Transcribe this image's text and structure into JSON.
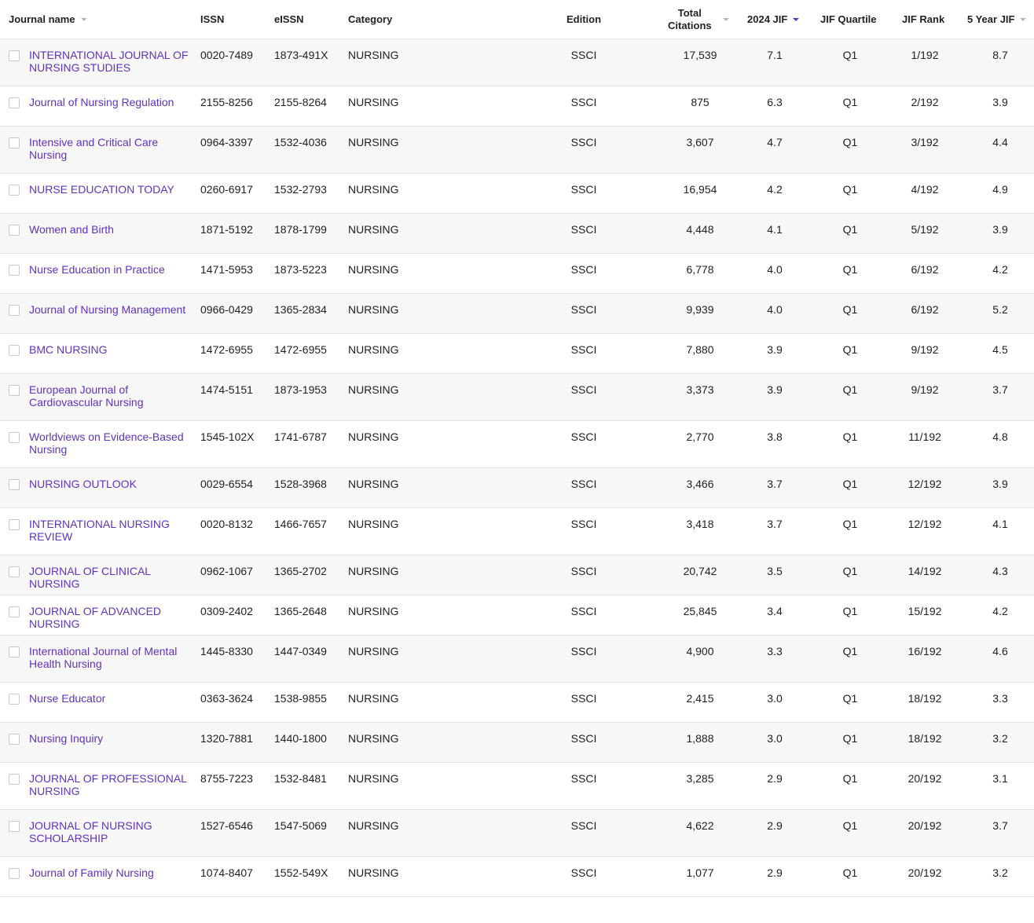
{
  "colors": {
    "link": "#5e33bf",
    "border": "#e3e3e3",
    "alt_row": "#f7f7f7",
    "active_sort": "#5e33bf"
  },
  "header": {
    "journal_name": "Journal name",
    "issn": "ISSN",
    "eissn": "eISSN",
    "category": "Category",
    "edition": "Edition",
    "total_citations_line1": "Total",
    "total_citations_line2": "Citations",
    "jif": "2024 JIF",
    "jif_quartile": "JIF Quartile",
    "jif_rank": "JIF Rank",
    "five_year_jif": "5 Year JIF"
  },
  "rows": [
    {
      "name": "INTERNATIONAL JOURNAL OF NURSING STUDIES",
      "issn": "0020-7489",
      "eissn": "1873-491X",
      "category": "NURSING",
      "edition": "SSCI",
      "citations": "17,539",
      "jif": "7.1",
      "quartile": "Q1",
      "rank": "1/192",
      "five_year": "8.7"
    },
    {
      "name": "Journal of Nursing Regulation",
      "issn": "2155-8256",
      "eissn": "2155-8264",
      "category": "NURSING",
      "edition": "SSCI",
      "citations": "875",
      "jif": "6.3",
      "quartile": "Q1",
      "rank": "2/192",
      "five_year": "3.9"
    },
    {
      "name": "Intensive and Critical Care Nursing",
      "issn": "0964-3397",
      "eissn": "1532-4036",
      "category": "NURSING",
      "edition": "SSCI",
      "citations": "3,607",
      "jif": "4.7",
      "quartile": "Q1",
      "rank": "3/192",
      "five_year": "4.4"
    },
    {
      "name": "NURSE EDUCATION TODAY",
      "issn": "0260-6917",
      "eissn": "1532-2793",
      "category": "NURSING",
      "edition": "SSCI",
      "citations": "16,954",
      "jif": "4.2",
      "quartile": "Q1",
      "rank": "4/192",
      "five_year": "4.9"
    },
    {
      "name": "Women and Birth",
      "issn": "1871-5192",
      "eissn": "1878-1799",
      "category": "NURSING",
      "edition": "SSCI",
      "citations": "4,448",
      "jif": "4.1",
      "quartile": "Q1",
      "rank": "5/192",
      "five_year": "3.9"
    },
    {
      "name": "Nurse Education in Practice",
      "issn": "1471-5953",
      "eissn": "1873-5223",
      "category": "NURSING",
      "edition": "SSCI",
      "citations": "6,778",
      "jif": "4.0",
      "quartile": "Q1",
      "rank": "6/192",
      "five_year": "4.2"
    },
    {
      "name": "Journal of Nursing Management",
      "issn": "0966-0429",
      "eissn": "1365-2834",
      "category": "NURSING",
      "edition": "SSCI",
      "citations": "9,939",
      "jif": "4.0",
      "quartile": "Q1",
      "rank": "6/192",
      "five_year": "5.2"
    },
    {
      "name": "BMC NURSING",
      "issn": "1472-6955",
      "eissn": "1472-6955",
      "category": "NURSING",
      "edition": "SSCI",
      "citations": "7,880",
      "jif": "3.9",
      "quartile": "Q1",
      "rank": "9/192",
      "five_year": "4.5"
    },
    {
      "name": "European Journal of Cardiovascular Nursing",
      "issn": "1474-5151",
      "eissn": "1873-1953",
      "category": "NURSING",
      "edition": "SSCI",
      "citations": "3,373",
      "jif": "3.9",
      "quartile": "Q1",
      "rank": "9/192",
      "five_year": "3.7"
    },
    {
      "name": "Worldviews on Evidence-Based Nursing",
      "issn": "1545-102X",
      "eissn": "1741-6787",
      "category": "NURSING",
      "edition": "SSCI",
      "citations": "2,770",
      "jif": "3.8",
      "quartile": "Q1",
      "rank": "11/192",
      "five_year": "4.8"
    },
    {
      "name": "NURSING OUTLOOK",
      "issn": "0029-6554",
      "eissn": "1528-3968",
      "category": "NURSING",
      "edition": "SSCI",
      "citations": "3,466",
      "jif": "3.7",
      "quartile": "Q1",
      "rank": "12/192",
      "five_year": "3.9"
    },
    {
      "name": "INTERNATIONAL NURSING REVIEW",
      "issn": "0020-8132",
      "eissn": "1466-7657",
      "category": "NURSING",
      "edition": "SSCI",
      "citations": "3,418",
      "jif": "3.7",
      "quartile": "Q1",
      "rank": "12/192",
      "five_year": "4.1"
    },
    {
      "name": "JOURNAL OF CLINICAL NURSING",
      "issn": "0962-1067",
      "eissn": "1365-2702",
      "category": "NURSING",
      "edition": "SSCI",
      "citations": "20,742",
      "jif": "3.5",
      "quartile": "Q1",
      "rank": "14/192",
      "five_year": "4.3"
    },
    {
      "name": "JOURNAL OF ADVANCED NURSING",
      "issn": "0309-2402",
      "eissn": "1365-2648",
      "category": "NURSING",
      "edition": "SSCI",
      "citations": "25,845",
      "jif": "3.4",
      "quartile": "Q1",
      "rank": "15/192",
      "five_year": "4.2"
    },
    {
      "name": "International Journal of Mental Health Nursing",
      "issn": "1445-8330",
      "eissn": "1447-0349",
      "category": "NURSING",
      "edition": "SSCI",
      "citations": "4,900",
      "jif": "3.3",
      "quartile": "Q1",
      "rank": "16/192",
      "five_year": "4.6"
    },
    {
      "name": "Nurse Educator",
      "issn": "0363-3624",
      "eissn": "1538-9855",
      "category": "NURSING",
      "edition": "SSCI",
      "citations": "2,415",
      "jif": "3.0",
      "quartile": "Q1",
      "rank": "18/192",
      "five_year": "3.3"
    },
    {
      "name": "Nursing Inquiry",
      "issn": "1320-7881",
      "eissn": "1440-1800",
      "category": "NURSING",
      "edition": "SSCI",
      "citations": "1,888",
      "jif": "3.0",
      "quartile": "Q1",
      "rank": "18/192",
      "five_year": "3.2"
    },
    {
      "name": "JOURNAL OF PROFESSIONAL NURSING",
      "issn": "8755-7223",
      "eissn": "1532-8481",
      "category": "NURSING",
      "edition": "SSCI",
      "citations": "3,285",
      "jif": "2.9",
      "quartile": "Q1",
      "rank": "20/192",
      "five_year": "3.1"
    },
    {
      "name": "JOURNAL OF NURSING SCHOLARSHIP",
      "issn": "1527-6546",
      "eissn": "1547-5069",
      "category": "NURSING",
      "edition": "SSCI",
      "citations": "4,622",
      "jif": "2.9",
      "quartile": "Q1",
      "rank": "20/192",
      "five_year": "3.7"
    },
    {
      "name": "Journal of Family Nursing",
      "issn": "1074-8407",
      "eissn": "1552-549X",
      "category": "NURSING",
      "edition": "SSCI",
      "citations": "1,077",
      "jif": "2.9",
      "quartile": "Q1",
      "rank": "20/192",
      "five_year": "3.2"
    }
  ]
}
